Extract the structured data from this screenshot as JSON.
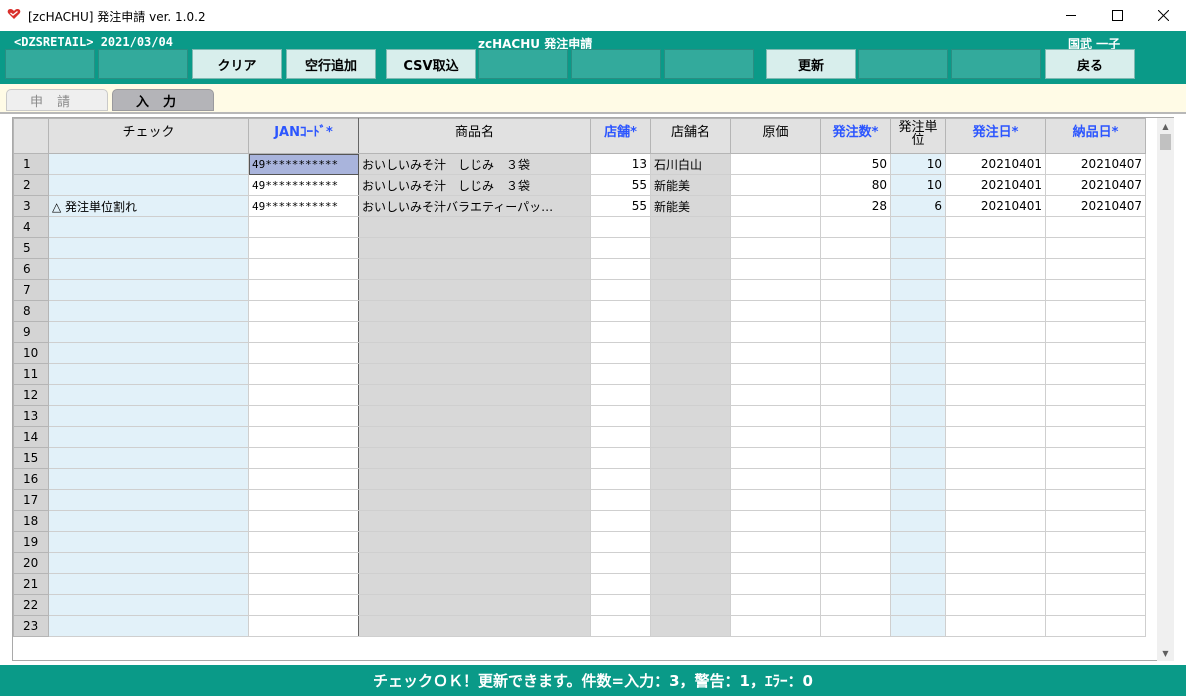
{
  "window": {
    "title": "[zcHACHU] 発注申請 ver. 1.0.2",
    "icons": {
      "app": "heart-logo-icon",
      "minimize": "minimize-icon",
      "maximize": "maximize-icon",
      "close": "close-icon"
    }
  },
  "header": {
    "company_date": "<DZSRETAIL>  2021/03/04",
    "app_name": "zcHACHU  発注申請",
    "user": "国武  一子"
  },
  "toolbar": {
    "buttons": [
      "",
      "",
      "クリア",
      "空行追加",
      "CSV取込",
      "",
      "",
      "",
      "更新",
      "",
      "",
      "戻る"
    ]
  },
  "tabs": [
    "申請",
    "入力"
  ],
  "grid": {
    "columns": [
      "チェック",
      "JANｺｰﾄﾞ*",
      "商品名",
      "店舗*",
      "店舗名",
      "原価",
      "発注数*",
      "発注単位",
      "発注日*",
      "納品日*"
    ],
    "rows": [
      {
        "no": "1",
        "check": "",
        "jan": "49***********",
        "name": "おいしいみそ汁　しじみ　３袋",
        "store": "13",
        "store_name": "石川白山",
        "cost": "",
        "qty": "50",
        "unit": "10",
        "order_date": "20210401",
        "delivery_date": "20210407"
      },
      {
        "no": "2",
        "check": "",
        "jan": "49***********",
        "name": "おいしいみそ汁　しじみ　３袋",
        "store": "55",
        "store_name": "新能美",
        "cost": "",
        "qty": "80",
        "unit": "10",
        "order_date": "20210401",
        "delivery_date": "20210407"
      },
      {
        "no": "3",
        "check": "△ 発注単位割れ",
        "jan": "49***********",
        "name": "おいしいみそ汁バラエティーパッ…",
        "store": "55",
        "store_name": "新能美",
        "cost": "",
        "qty": "28",
        "unit": "6",
        "order_date": "20210401",
        "delivery_date": "20210407"
      },
      {
        "no": "4"
      },
      {
        "no": "5"
      },
      {
        "no": "6"
      },
      {
        "no": "7"
      },
      {
        "no": "8"
      },
      {
        "no": "9"
      },
      {
        "no": "10"
      },
      {
        "no": "11"
      },
      {
        "no": "12"
      },
      {
        "no": "13"
      },
      {
        "no": "14"
      },
      {
        "no": "15"
      },
      {
        "no": "16"
      },
      {
        "no": "17"
      },
      {
        "no": "18"
      },
      {
        "no": "19"
      },
      {
        "no": "20"
      },
      {
        "no": "21"
      },
      {
        "no": "22"
      },
      {
        "no": "23"
      }
    ]
  },
  "status": "チェックＯＫ！更新できます。件数=入力：3，警告：1，ｴﾗｰ：0",
  "colors": {
    "teal": "#0a9a88",
    "required_header": "#2b55ff"
  }
}
